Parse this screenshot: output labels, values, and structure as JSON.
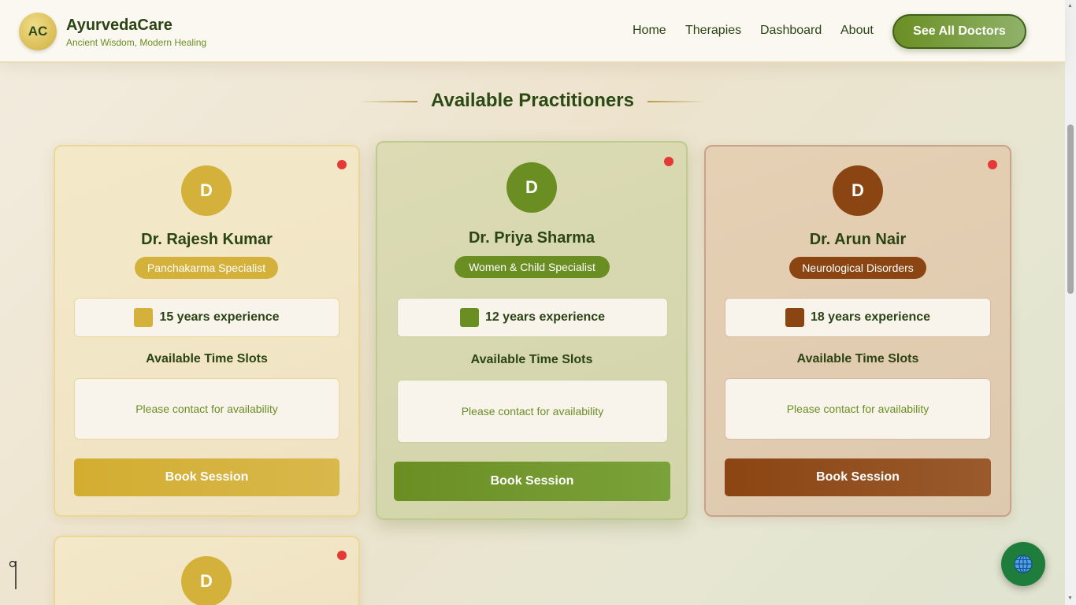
{
  "header": {
    "logo_initials": "AC",
    "brand_name": "AyurvedaCare",
    "tagline": "Ancient Wisdom, Modern Healing",
    "nav": [
      "Home",
      "Therapies",
      "Dashboard",
      "About"
    ],
    "cta_label": "See All Doctors"
  },
  "section": {
    "title": "Available Practitioners"
  },
  "doctors": [
    {
      "initial": "D",
      "name": "Dr. Rajesh Kumar",
      "specialty": "Panchakarma Specialist",
      "experience": "15 years experience",
      "slots_title": "Available Time Slots",
      "slots_text": "Please contact for availability",
      "book_label": "Book Session",
      "accent": "#d4b13a"
    },
    {
      "initial": "D",
      "name": "Dr. Priya Sharma",
      "specialty": "Women & Child Specialist",
      "experience": "12 years experience",
      "slots_title": "Available Time Slots",
      "slots_text": "Please contact for availability",
      "book_label": "Book Session",
      "accent": "#6b8e23"
    },
    {
      "initial": "D",
      "name": "Dr. Arun Nair",
      "specialty": "Neurological Disorders",
      "experience": "18 years experience",
      "slots_title": "Available Time Slots",
      "slots_text": "Please contact for availability",
      "book_label": "Book Session",
      "accent": "#8b4513"
    },
    {
      "initial": "D",
      "accent": "#d4b13a"
    }
  ],
  "icons": {
    "floating": "globe-icon",
    "status": "status-dot"
  }
}
